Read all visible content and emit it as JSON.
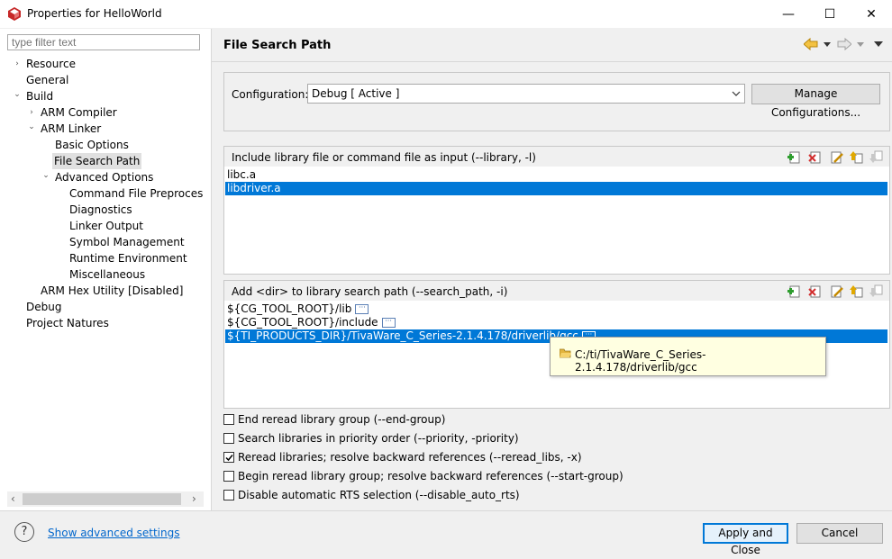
{
  "window": {
    "title": "Properties for HelloWorld",
    "controls": {
      "minimize": "—",
      "maximize": "☐",
      "close": "✕"
    }
  },
  "sidebar": {
    "filter_placeholder": "type filter text",
    "tree": [
      {
        "label": "Resource",
        "toggle": "›"
      },
      {
        "label": "General"
      },
      {
        "label": "Build",
        "toggle": "⌄"
      },
      {
        "label": "ARM Compiler",
        "toggle": "›"
      },
      {
        "label": "ARM Linker",
        "toggle": "⌄"
      },
      {
        "label": "Basic Options"
      },
      {
        "label": "File Search Path"
      },
      {
        "label": "Advanced Options",
        "toggle": "⌄"
      },
      {
        "label": "Command File Preprocessin"
      },
      {
        "label": "Diagnostics"
      },
      {
        "label": "Linker Output"
      },
      {
        "label": "Symbol Management"
      },
      {
        "label": "Runtime Environment"
      },
      {
        "label": "Miscellaneous"
      },
      {
        "label": "ARM Hex Utility  [Disabled]"
      },
      {
        "label": "Debug"
      },
      {
        "label": "Project Natures"
      }
    ],
    "scroll_left": "‹",
    "scroll_right": "›"
  },
  "page": {
    "title": "File Search Path",
    "configuration_label": "Configuration:",
    "configuration_value": "Debug  [ Active ]",
    "manage_button": "Manage Configurations...",
    "libs_panel": {
      "header": "Include library file or command file as input (--library, -l)",
      "items": [
        "libc.a",
        "libdriver.a"
      ],
      "selected_index": 1
    },
    "paths_panel": {
      "header": "Add <dir> to library search path (--search_path, -i)",
      "items": [
        "${CG_TOOL_ROOT}/lib",
        "${CG_TOOL_ROOT}/include",
        "${TI_PRODUCTS_DIR}/TivaWare_C_Series-2.1.4.178/driverlib/gcc"
      ],
      "selected_index": 2,
      "tooltip": "C:/ti/TivaWare_C_Series-2.1.4.178/driverlib/gcc"
    },
    "options": [
      {
        "label": "End reread library group (--end-group)",
        "checked": false
      },
      {
        "label": "Search libraries in priority order (--priority, -priority)",
        "checked": false
      },
      {
        "label": "Reread libraries; resolve backward references (--reread_libs, -x)",
        "checked": true
      },
      {
        "label": "Begin reread library group; resolve backward references (--start-group)",
        "checked": false
      },
      {
        "label": "Disable automatic RTS selection (--disable_auto_rts)",
        "checked": false
      }
    ]
  },
  "footer": {
    "help_glyph": "?",
    "advanced_link": "Show advanced settings",
    "apply_button": "Apply and Close",
    "cancel_button": "Cancel"
  },
  "colors": {
    "selection": "#0078d7",
    "link": "#0066cc",
    "tooltip_bg": "#ffffe1"
  }
}
